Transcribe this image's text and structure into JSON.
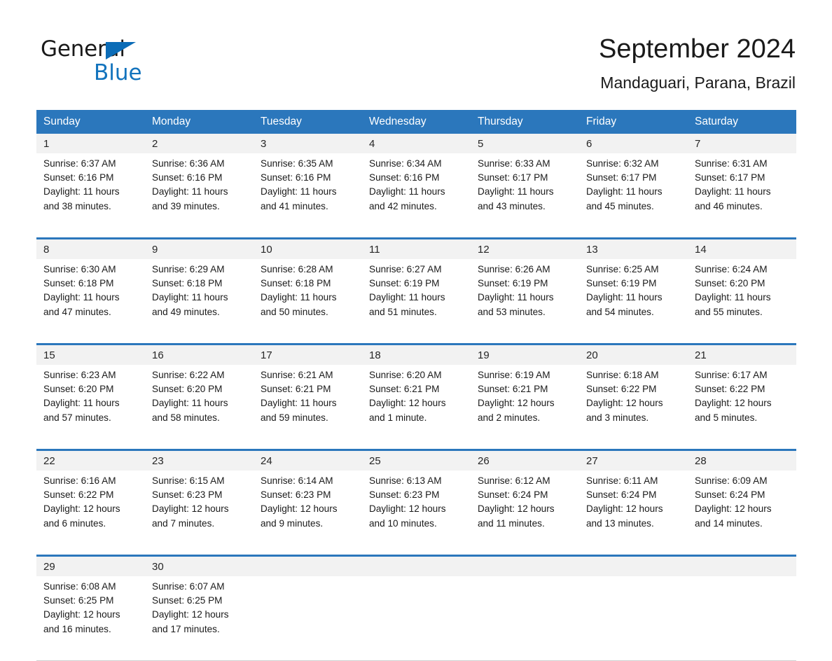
{
  "brand": {
    "name_part1": "General",
    "name_part2": "Blue",
    "triangle_color": "#0b6cb7",
    "blue_text_color": "#1273bd"
  },
  "header": {
    "title": "September 2024",
    "location": "Mandaguari, Parana, Brazil",
    "accent_color": "#2b77bc",
    "number_band_color": "#f2f2f2"
  },
  "weekday_headers": [
    "Sunday",
    "Monday",
    "Tuesday",
    "Wednesday",
    "Thursday",
    "Friday",
    "Saturday"
  ],
  "weeks": [
    {
      "days": [
        {
          "number": "1",
          "sunrise": "Sunrise: 6:37 AM",
          "sunset": "Sunset: 6:16 PM",
          "daylight_line1": "Daylight: 11 hours",
          "daylight_line2": "and 38 minutes."
        },
        {
          "number": "2",
          "sunrise": "Sunrise: 6:36 AM",
          "sunset": "Sunset: 6:16 PM",
          "daylight_line1": "Daylight: 11 hours",
          "daylight_line2": "and 39 minutes."
        },
        {
          "number": "3",
          "sunrise": "Sunrise: 6:35 AM",
          "sunset": "Sunset: 6:16 PM",
          "daylight_line1": "Daylight: 11 hours",
          "daylight_line2": "and 41 minutes."
        },
        {
          "number": "4",
          "sunrise": "Sunrise: 6:34 AM",
          "sunset": "Sunset: 6:16 PM",
          "daylight_line1": "Daylight: 11 hours",
          "daylight_line2": "and 42 minutes."
        },
        {
          "number": "5",
          "sunrise": "Sunrise: 6:33 AM",
          "sunset": "Sunset: 6:17 PM",
          "daylight_line1": "Daylight: 11 hours",
          "daylight_line2": "and 43 minutes."
        },
        {
          "number": "6",
          "sunrise": "Sunrise: 6:32 AM",
          "sunset": "Sunset: 6:17 PM",
          "daylight_line1": "Daylight: 11 hours",
          "daylight_line2": "and 45 minutes."
        },
        {
          "number": "7",
          "sunrise": "Sunrise: 6:31 AM",
          "sunset": "Sunset: 6:17 PM",
          "daylight_line1": "Daylight: 11 hours",
          "daylight_line2": "and 46 minutes."
        }
      ]
    },
    {
      "days": [
        {
          "number": "8",
          "sunrise": "Sunrise: 6:30 AM",
          "sunset": "Sunset: 6:18 PM",
          "daylight_line1": "Daylight: 11 hours",
          "daylight_line2": "and 47 minutes."
        },
        {
          "number": "9",
          "sunrise": "Sunrise: 6:29 AM",
          "sunset": "Sunset: 6:18 PM",
          "daylight_line1": "Daylight: 11 hours",
          "daylight_line2": "and 49 minutes."
        },
        {
          "number": "10",
          "sunrise": "Sunrise: 6:28 AM",
          "sunset": "Sunset: 6:18 PM",
          "daylight_line1": "Daylight: 11 hours",
          "daylight_line2": "and 50 minutes."
        },
        {
          "number": "11",
          "sunrise": "Sunrise: 6:27 AM",
          "sunset": "Sunset: 6:19 PM",
          "daylight_line1": "Daylight: 11 hours",
          "daylight_line2": "and 51 minutes."
        },
        {
          "number": "12",
          "sunrise": "Sunrise: 6:26 AM",
          "sunset": "Sunset: 6:19 PM",
          "daylight_line1": "Daylight: 11 hours",
          "daylight_line2": "and 53 minutes."
        },
        {
          "number": "13",
          "sunrise": "Sunrise: 6:25 AM",
          "sunset": "Sunset: 6:19 PM",
          "daylight_line1": "Daylight: 11 hours",
          "daylight_line2": "and 54 minutes."
        },
        {
          "number": "14",
          "sunrise": "Sunrise: 6:24 AM",
          "sunset": "Sunset: 6:20 PM",
          "daylight_line1": "Daylight: 11 hours",
          "daylight_line2": "and 55 minutes."
        }
      ]
    },
    {
      "days": [
        {
          "number": "15",
          "sunrise": "Sunrise: 6:23 AM",
          "sunset": "Sunset: 6:20 PM",
          "daylight_line1": "Daylight: 11 hours",
          "daylight_line2": "and 57 minutes."
        },
        {
          "number": "16",
          "sunrise": "Sunrise: 6:22 AM",
          "sunset": "Sunset: 6:20 PM",
          "daylight_line1": "Daylight: 11 hours",
          "daylight_line2": "and 58 minutes."
        },
        {
          "number": "17",
          "sunrise": "Sunrise: 6:21 AM",
          "sunset": "Sunset: 6:21 PM",
          "daylight_line1": "Daylight: 11 hours",
          "daylight_line2": "and 59 minutes."
        },
        {
          "number": "18",
          "sunrise": "Sunrise: 6:20 AM",
          "sunset": "Sunset: 6:21 PM",
          "daylight_line1": "Daylight: 12 hours",
          "daylight_line2": "and 1 minute."
        },
        {
          "number": "19",
          "sunrise": "Sunrise: 6:19 AM",
          "sunset": "Sunset: 6:21 PM",
          "daylight_line1": "Daylight: 12 hours",
          "daylight_line2": "and 2 minutes."
        },
        {
          "number": "20",
          "sunrise": "Sunrise: 6:18 AM",
          "sunset": "Sunset: 6:22 PM",
          "daylight_line1": "Daylight: 12 hours",
          "daylight_line2": "and 3 minutes."
        },
        {
          "number": "21",
          "sunrise": "Sunrise: 6:17 AM",
          "sunset": "Sunset: 6:22 PM",
          "daylight_line1": "Daylight: 12 hours",
          "daylight_line2": "and 5 minutes."
        }
      ]
    },
    {
      "days": [
        {
          "number": "22",
          "sunrise": "Sunrise: 6:16 AM",
          "sunset": "Sunset: 6:22 PM",
          "daylight_line1": "Daylight: 12 hours",
          "daylight_line2": "and 6 minutes."
        },
        {
          "number": "23",
          "sunrise": "Sunrise: 6:15 AM",
          "sunset": "Sunset: 6:23 PM",
          "daylight_line1": "Daylight: 12 hours",
          "daylight_line2": "and 7 minutes."
        },
        {
          "number": "24",
          "sunrise": "Sunrise: 6:14 AM",
          "sunset": "Sunset: 6:23 PM",
          "daylight_line1": "Daylight: 12 hours",
          "daylight_line2": "and 9 minutes."
        },
        {
          "number": "25",
          "sunrise": "Sunrise: 6:13 AM",
          "sunset": "Sunset: 6:23 PM",
          "daylight_line1": "Daylight: 12 hours",
          "daylight_line2": "and 10 minutes."
        },
        {
          "number": "26",
          "sunrise": "Sunrise: 6:12 AM",
          "sunset": "Sunset: 6:24 PM",
          "daylight_line1": "Daylight: 12 hours",
          "daylight_line2": "and 11 minutes."
        },
        {
          "number": "27",
          "sunrise": "Sunrise: 6:11 AM",
          "sunset": "Sunset: 6:24 PM",
          "daylight_line1": "Daylight: 12 hours",
          "daylight_line2": "and 13 minutes."
        },
        {
          "number": "28",
          "sunrise": "Sunrise: 6:09 AM",
          "sunset": "Sunset: 6:24 PM",
          "daylight_line1": "Daylight: 12 hours",
          "daylight_line2": "and 14 minutes."
        }
      ]
    },
    {
      "days": [
        {
          "number": "29",
          "sunrise": "Sunrise: 6:08 AM",
          "sunset": "Sunset: 6:25 PM",
          "daylight_line1": "Daylight: 12 hours",
          "daylight_line2": "and 16 minutes."
        },
        {
          "number": "30",
          "sunrise": "Sunrise: 6:07 AM",
          "sunset": "Sunset: 6:25 PM",
          "daylight_line1": "Daylight: 12 hours",
          "daylight_line2": "and 17 minutes."
        },
        {
          "number": "",
          "sunrise": "",
          "sunset": "",
          "daylight_line1": "",
          "daylight_line2": ""
        },
        {
          "number": "",
          "sunrise": "",
          "sunset": "",
          "daylight_line1": "",
          "daylight_line2": ""
        },
        {
          "number": "",
          "sunrise": "",
          "sunset": "",
          "daylight_line1": "",
          "daylight_line2": ""
        },
        {
          "number": "",
          "sunrise": "",
          "sunset": "",
          "daylight_line1": "",
          "daylight_line2": ""
        },
        {
          "number": "",
          "sunrise": "",
          "sunset": "",
          "daylight_line1": "",
          "daylight_line2": ""
        }
      ]
    }
  ]
}
